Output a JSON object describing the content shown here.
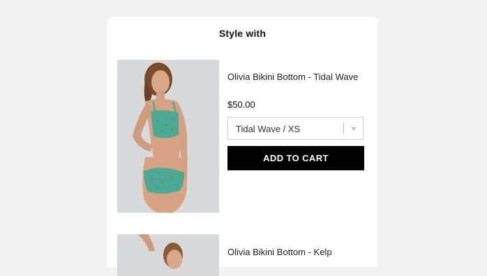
{
  "section": {
    "title": "Style with"
  },
  "products": [
    {
      "name": "Olivia Bikini Bottom - Tidal Wave",
      "price": "$50.00",
      "variant": "Tidal Wave / XS",
      "cta_label": "ADD TO CART",
      "image_icon": "model-photo"
    },
    {
      "name": "Olivia Bikini Bottom - Kelp",
      "image_icon": "model-photo"
    }
  ],
  "colors": {
    "background": "#f2f2f2",
    "panel": "#ffffff",
    "button": "#000000",
    "button_text": "#ffffff",
    "swimsuit": "#4fa894"
  }
}
